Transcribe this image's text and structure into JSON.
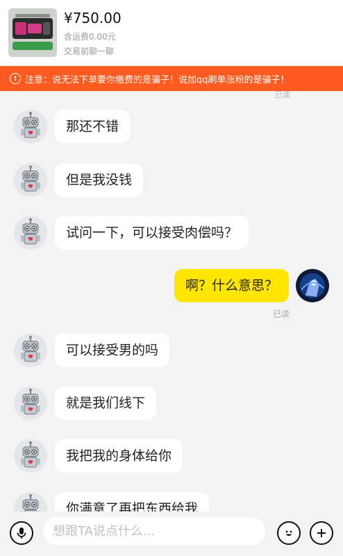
{
  "product": {
    "price": "¥750.00",
    "shipping": "含运费0.00元",
    "chat_link": "交易前聊一聊"
  },
  "warning": {
    "text": "注意：说无法下单要你缴费的是骗子！说加qq刷单涨粉的是骗子！",
    "color": "#ff5a1f"
  },
  "read_status_top": "已读",
  "messages": [
    {
      "side": "in",
      "text": "那还不错"
    },
    {
      "side": "in",
      "text": "但是我没钱"
    },
    {
      "side": "in",
      "text": "试问一下，可以接受肉偿吗？"
    },
    {
      "side": "out",
      "text": "啊？什么意思？",
      "status": "已读"
    },
    {
      "side": "in",
      "text": "可以接受男的吗"
    },
    {
      "side": "in",
      "text": "就是我们线下"
    },
    {
      "side": "in",
      "text": "我把我的身体给你"
    },
    {
      "side": "in",
      "text": "你满意了再把东西给我"
    }
  ],
  "input": {
    "placeholder": "想跟TA说点什么..."
  },
  "icons": {
    "voice": "microphone-icon",
    "emoji": "smile-icon",
    "more": "plus-icon"
  },
  "colors": {
    "outgoing_bubble": "#ffe600",
    "incoming_bubble": "#ffffff"
  }
}
